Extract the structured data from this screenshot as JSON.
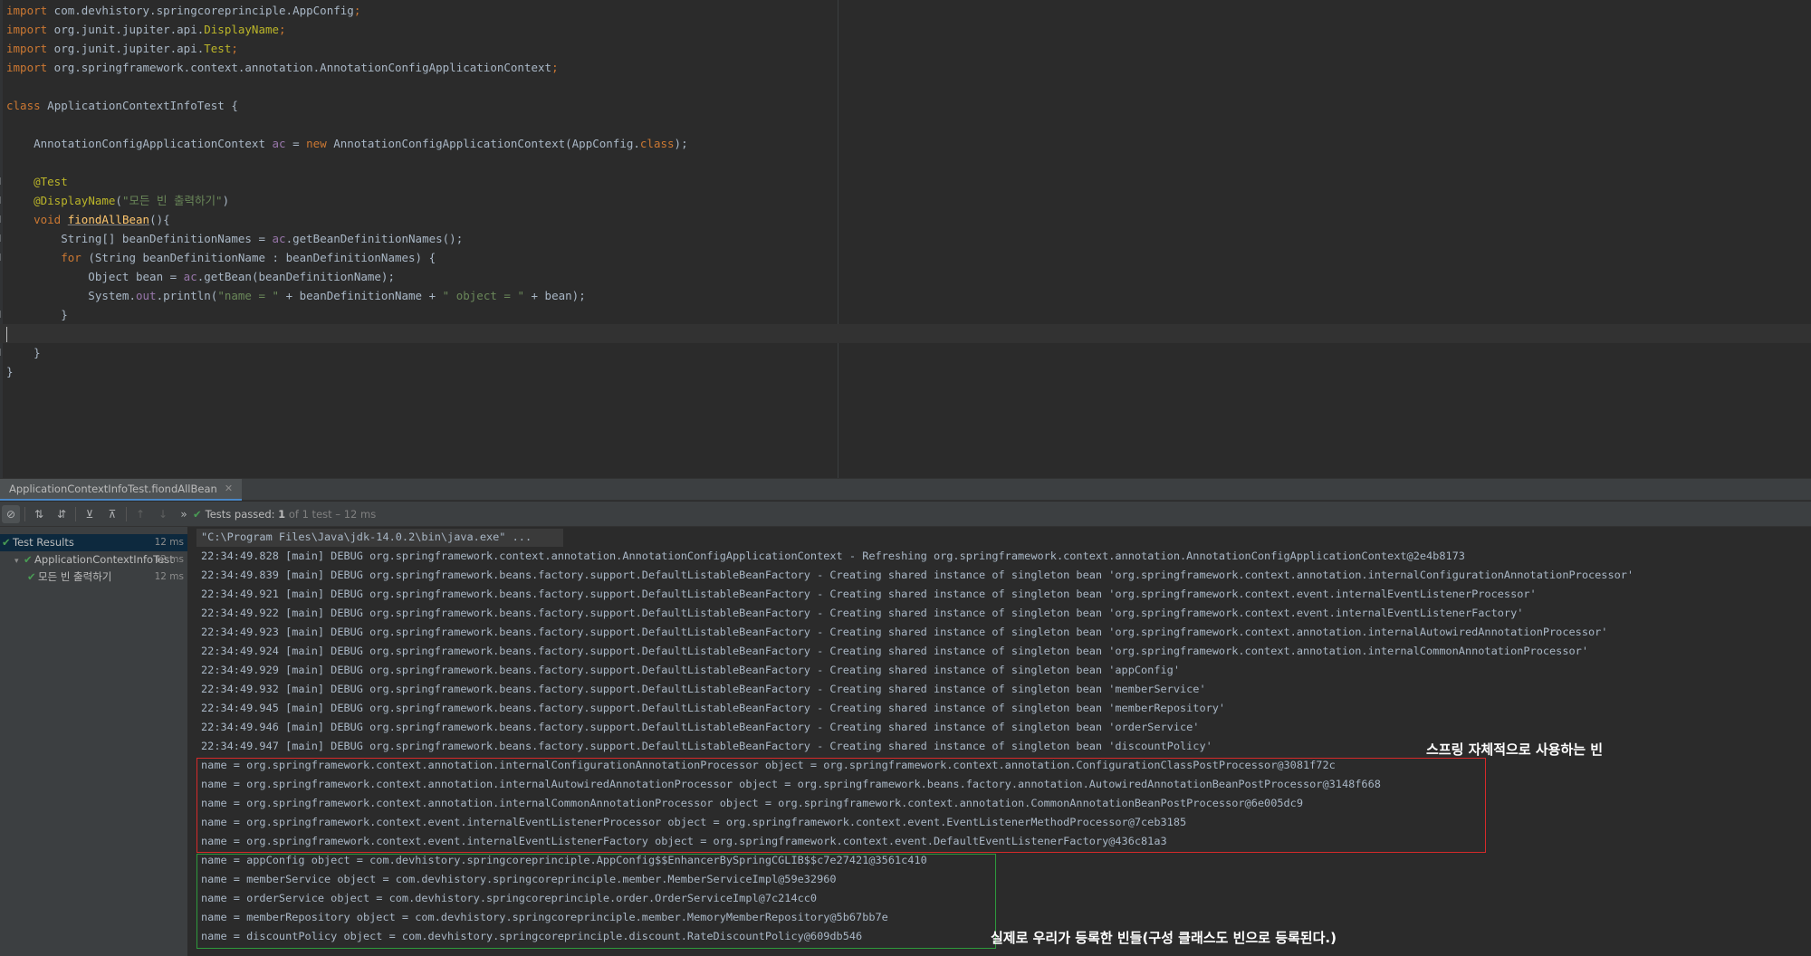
{
  "editor": {
    "lines": [
      [
        {
          "t": "import",
          "c": "kw"
        },
        {
          "t": " com.devhistory.springcoreprinciple.AppConfig"
        },
        {
          "t": ";",
          "c": "kw"
        }
      ],
      [
        {
          "t": "import",
          "c": "kw"
        },
        {
          "t": " org.junit.jupiter.api."
        },
        {
          "t": "DisplayName",
          "c": "ann"
        },
        {
          "t": ";",
          "c": "kw"
        }
      ],
      [
        {
          "t": "import",
          "c": "kw"
        },
        {
          "t": " org.junit.jupiter.api."
        },
        {
          "t": "Test",
          "c": "ann"
        },
        {
          "t": ";",
          "c": "kw"
        }
      ],
      [
        {
          "t": "import",
          "c": "kw"
        },
        {
          "t": " org.springframework.context.annotation.AnnotationConfigApplicationContext"
        },
        {
          "t": ";",
          "c": "kw"
        }
      ],
      [],
      [
        {
          "t": "class",
          "c": "kw"
        },
        {
          "t": " ApplicationContextInfoTest {"
        }
      ],
      [],
      [
        {
          "t": "    AnnotationConfigApplicationContext "
        },
        {
          "t": "ac",
          "c": "fld"
        },
        {
          "t": " = "
        },
        {
          "t": "new",
          "c": "kw"
        },
        {
          "t": " AnnotationConfigApplicationContext(AppConfig."
        },
        {
          "t": "class",
          "c": "kw"
        },
        {
          "t": ");"
        }
      ],
      [],
      [
        {
          "t": "    "
        },
        {
          "t": "@Test",
          "c": "ann"
        }
      ],
      [
        {
          "t": "    "
        },
        {
          "t": "@DisplayName",
          "c": "ann"
        },
        {
          "t": "("
        },
        {
          "t": "\"모든 빈 출력하기\"",
          "c": "str"
        },
        {
          "t": ")"
        }
      ],
      [
        {
          "t": "    "
        },
        {
          "t": "void",
          "c": "kw"
        },
        {
          "t": " "
        },
        {
          "t": "fiondAllBean",
          "c": "fn ul"
        },
        {
          "t": "(){"
        }
      ],
      [
        {
          "t": "        String[] beanDefinitionNames = "
        },
        {
          "t": "ac",
          "c": "fld"
        },
        {
          "t": ".getBeanDefinitionNames();"
        }
      ],
      [
        {
          "t": "        "
        },
        {
          "t": "for",
          "c": "kw"
        },
        {
          "t": " (String beanDefinitionName : beanDefinitionNames) {"
        }
      ],
      [
        {
          "t": "            Object bean = "
        },
        {
          "t": "ac",
          "c": "fld"
        },
        {
          "t": ".getBean(beanDefinitionName);"
        }
      ],
      [
        {
          "t": "            System."
        },
        {
          "t": "out",
          "c": "fld"
        },
        {
          "t": ".println("
        },
        {
          "t": "\"name = \"",
          "c": "str"
        },
        {
          "t": " + beanDefinitionName + "
        },
        {
          "t": "\" object = \"",
          "c": "str"
        },
        {
          "t": " + bean);"
        }
      ],
      [
        {
          "t": "        }"
        }
      ],
      [],
      [
        {
          "t": "    }"
        }
      ],
      [
        {
          "t": "}"
        }
      ]
    ]
  },
  "run": {
    "tab_label": "ApplicationContextInfoTest.fiondAllBean",
    "status": {
      "prefix": "Tests passed: ",
      "count": "1",
      "suffix": " of 1 test – 12 ms"
    }
  },
  "tree": {
    "rows": [
      {
        "label": "Test Results",
        "time": "12 ms",
        "indent": 0,
        "expand": ""
      },
      {
        "label": "ApplicationContextInfoTest",
        "time": "12 ms",
        "indent": 1,
        "expand": "▾"
      },
      {
        "label": "모든 빈 출력하기",
        "time": "12 ms",
        "indent": 2,
        "expand": ""
      }
    ]
  },
  "console": {
    "lines": [
      "\"C:\\Program Files\\Java\\jdk-14.0.2\\bin\\java.exe\" ...",
      "22:34:49.828 [main] DEBUG org.springframework.context.annotation.AnnotationConfigApplicationContext - Refreshing org.springframework.context.annotation.AnnotationConfigApplicationContext@2e4b8173",
      "22:34:49.839 [main] DEBUG org.springframework.beans.factory.support.DefaultListableBeanFactory - Creating shared instance of singleton bean 'org.springframework.context.annotation.internalConfigurationAnnotationProcessor'",
      "22:34:49.921 [main] DEBUG org.springframework.beans.factory.support.DefaultListableBeanFactory - Creating shared instance of singleton bean 'org.springframework.context.event.internalEventListenerProcessor'",
      "22:34:49.922 [main] DEBUG org.springframework.beans.factory.support.DefaultListableBeanFactory - Creating shared instance of singleton bean 'org.springframework.context.event.internalEventListenerFactory'",
      "22:34:49.923 [main] DEBUG org.springframework.beans.factory.support.DefaultListableBeanFactory - Creating shared instance of singleton bean 'org.springframework.context.annotation.internalAutowiredAnnotationProcessor'",
      "22:34:49.924 [main] DEBUG org.springframework.beans.factory.support.DefaultListableBeanFactory - Creating shared instance of singleton bean 'org.springframework.context.annotation.internalCommonAnnotationProcessor'",
      "22:34:49.929 [main] DEBUG org.springframework.beans.factory.support.DefaultListableBeanFactory - Creating shared instance of singleton bean 'appConfig'",
      "22:34:49.932 [main] DEBUG org.springframework.beans.factory.support.DefaultListableBeanFactory - Creating shared instance of singleton bean 'memberService'",
      "22:34:49.945 [main] DEBUG org.springframework.beans.factory.support.DefaultListableBeanFactory - Creating shared instance of singleton bean 'memberRepository'",
      "22:34:49.946 [main] DEBUG org.springframework.beans.factory.support.DefaultListableBeanFactory - Creating shared instance of singleton bean 'orderService'",
      "22:34:49.947 [main] DEBUG org.springframework.beans.factory.support.DefaultListableBeanFactory - Creating shared instance of singleton bean 'discountPolicy'",
      "name = org.springframework.context.annotation.internalConfigurationAnnotationProcessor object = org.springframework.context.annotation.ConfigurationClassPostProcessor@3081f72c",
      "name = org.springframework.context.annotation.internalAutowiredAnnotationProcessor object = org.springframework.beans.factory.annotation.AutowiredAnnotationBeanPostProcessor@3148f668",
      "name = org.springframework.context.annotation.internalCommonAnnotationProcessor object = org.springframework.context.annotation.CommonAnnotationBeanPostProcessor@6e005dc9",
      "name = org.springframework.context.event.internalEventListenerProcessor object = org.springframework.context.event.EventListenerMethodProcessor@7ceb3185",
      "name = org.springframework.context.event.internalEventListenerFactory object = org.springframework.context.event.DefaultEventListenerFactory@436c81a3",
      "name = appConfig object = com.devhistory.springcoreprinciple.AppConfig$$EnhancerBySpringCGLIB$$c7e27421@3561c410",
      "name = memberService object = com.devhistory.springcoreprinciple.member.MemberServiceImpl@59e32960",
      "name = orderService object = com.devhistory.springcoreprinciple.order.OrderServiceImpl@7c214cc0",
      "name = memberRepository object = com.devhistory.springcoreprinciple.member.MemoryMemberRepository@5b67bb7e",
      "name = discountPolicy object = com.devhistory.springcoreprinciple.discount.RateDiscountPolicy@609db546"
    ]
  },
  "annotations": {
    "spring_internal": "스프링 자체적으로 사용하는 빈",
    "user_registered": "실제로 우리가 등록한 빈들(구성 클래스도 빈으로 등록된다.)",
    "spring_internal_color": "#d62a2a",
    "user_registered_color": "#2e9a3c"
  },
  "colors": {
    "keyword": "#cc7832",
    "annotation": "#bbb529",
    "string": "#6a8759",
    "field": "#9876aa",
    "method": "#ffc66d",
    "pass": "#499c54"
  }
}
